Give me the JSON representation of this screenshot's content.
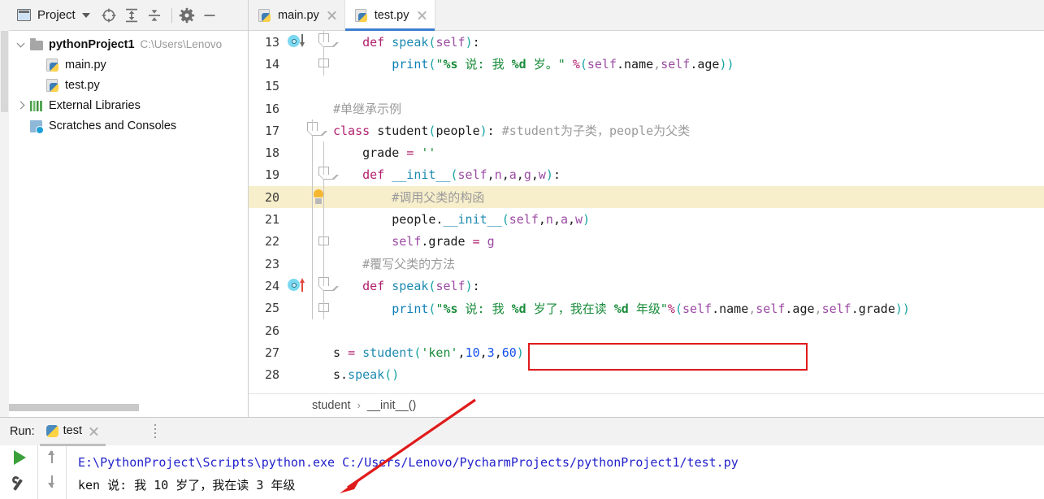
{
  "window": {
    "project_panel": {
      "title": "Project",
      "toolbar_icons": [
        "locate-icon",
        "expand-all-icon",
        "collapse-all-icon",
        "settings-gear-icon",
        "minimize-icon"
      ],
      "tree": [
        {
          "label": "pythonProject1",
          "path_hint": "C:\\Users\\Lenovo",
          "icon": "folder-icon",
          "twisty": "open",
          "depth": 0,
          "bold": true
        },
        {
          "label": "main.py",
          "path_hint": "",
          "icon": "python-file-icon",
          "twisty": "none",
          "depth": 1,
          "bold": false
        },
        {
          "label": "test.py",
          "path_hint": "",
          "icon": "python-file-icon",
          "twisty": "none",
          "depth": 1,
          "bold": false
        },
        {
          "label": "External Libraries",
          "path_hint": "",
          "icon": "library-icon",
          "twisty": "closed",
          "depth": 0,
          "bold": false
        },
        {
          "label": "Scratches and Consoles",
          "path_hint": "",
          "icon": "scratches-icon",
          "twisty": "none",
          "depth": 0,
          "bold": false
        }
      ]
    },
    "editor": {
      "tabs": [
        {
          "label": "main.py",
          "active": false
        },
        {
          "label": "test.py",
          "active": true
        }
      ],
      "breadcrumb": {
        "parts": [
          "student",
          "__init__()"
        ],
        "separator": "›"
      },
      "lines": [
        {
          "num": "13",
          "gutter": "impl-down",
          "fold": "top",
          "indent": 1,
          "html": "<span class='indent1'></span><span class='kw'>def</span> <span class='fn'>speak</span><span class='par'>(</span><span class='self'>self</span><span class='par'>)</span>:"
        },
        {
          "num": "14",
          "gutter": "",
          "fold": "bot",
          "indent": 2,
          "html": "<span class='indent2'></span><span class='bip'>print</span><span class='par'>(</span><span class='str'>\"</span><span class='strf'>%s</span><span class='str'> 说: 我 </span><span class='strf'>%d</span><span class='str'> 岁。\"</span> <span class='pct'>%</span><span class='par'>(</span><span class='self'>self</span>.name<span class='com'>,</span><span class='self'>self</span>.age<span class='par'>))</span>"
        },
        {
          "num": "15",
          "gutter": "",
          "fold": "",
          "indent": 0,
          "html": ""
        },
        {
          "num": "16",
          "gutter": "",
          "fold": "",
          "indent": 0,
          "html": "<span class='com'>#单继承示例</span>"
        },
        {
          "num": "17",
          "gutter": "",
          "fold": "top-flat",
          "indent": 0,
          "html": "<span class='kw'>class</span> <span class='cls'>student</span><span class='par'>(</span>people<span class='par'>)</span>: <span class='com'>#student为子类，people为父类</span>"
        },
        {
          "num": "18",
          "gutter": "",
          "fold": "",
          "indent": 1,
          "html": "<span class='indent1'></span>grade <span class='op'>=</span> <span class='str'>''</span>"
        },
        {
          "num": "19",
          "gutter": "",
          "fold": "top",
          "indent": 1,
          "html": "<span class='indent1'></span><span class='kw'>def</span> <span class='fn'>__init__</span><span class='par'>(</span><span class='self'>self</span>,<span class='var'>n</span>,<span class='var'>a</span>,<span class='var'>g</span>,<span class='var'>w</span><span class='par'>)</span>:"
        },
        {
          "num": "20",
          "gutter": "bulb",
          "fold": "",
          "indent": 2,
          "highlight": true,
          "html": "<span class='indent2'></span><span class='com'>#调用父类的构函</span>"
        },
        {
          "num": "21",
          "gutter": "",
          "fold": "",
          "indent": 2,
          "html": "<span class='indent2'></span>people.<span class='fn'>__init__</span><span class='par'>(</span><span class='self'>self</span>,<span class='var'>n</span>,<span class='var'>a</span>,<span class='var'>w</span><span class='par'>)</span>"
        },
        {
          "num": "22",
          "gutter": "",
          "fold": "bot",
          "indent": 2,
          "html": "<span class='indent2'></span><span class='self'>self</span>.grade <span class='op'>=</span> <span class='var'>g</span>"
        },
        {
          "num": "23",
          "gutter": "",
          "fold": "",
          "indent": 1,
          "html": "<span class='indent1'></span><span class='com'>#覆写父类的方法</span>"
        },
        {
          "num": "24",
          "gutter": "over-up",
          "fold": "top",
          "indent": 1,
          "html": "<span class='indent1'></span><span class='kw'>def</span> <span class='fn'>speak</span><span class='par'>(</span><span class='self'>self</span><span class='par'>)</span>:"
        },
        {
          "num": "25",
          "gutter": "",
          "fold": "bot",
          "indent": 2,
          "html": "<span class='indent2'></span><span class='bip'>print</span><span class='par'>(</span><span class='str'>\"</span><span class='strf'>%s</span><span class='str'> 说: 我 </span><span class='strf'>%d</span><span class='str'> 岁了，我在读 </span><span class='strf'>%d</span><span class='str'> 年级\"</span><span class='pct'>%</span><span class='par'>(</span><span class='self'>self</span>.name<span class='com'>,</span><span class='self'>self</span>.age<span class='com'>,</span><span class='self'>self</span>.grade<span class='par'>))</span>"
        },
        {
          "num": "26",
          "gutter": "",
          "fold": "",
          "indent": 0,
          "html": ""
        },
        {
          "num": "27",
          "gutter": "",
          "fold": "",
          "indent": 0,
          "html": "s <span class='op'>=</span> <span class='fn'>student</span><span class='par'>(</span><span class='str'>'ken'</span>,<span class='num'>10</span>,<span class='num'>3</span>,<span class='num'>60</span><span class='par'>)</span>"
        },
        {
          "num": "28",
          "gutter": "",
          "fold": "",
          "indent": 0,
          "html": "s.<span class='fn'>speak</span><span class='par'>()</span>"
        }
      ],
      "annotation": {
        "type": "red-rectangle",
        "target_line": "27"
      }
    },
    "run_panel": {
      "label": "Run:",
      "tab_label": "test",
      "buttons": [
        "run-icon",
        "wrench-icon",
        "scroll-up-icon",
        "scroll-down-icon"
      ],
      "console": [
        {
          "text": "E:\\PythonProject\\Scripts\\python.exe C:/Users/Lenovo/PycharmProjects/pythonProject1/test.py",
          "kind": "command"
        },
        {
          "text": "ken 说: 我 10 岁了，我在读 3 年级",
          "kind": "output"
        }
      ],
      "annotation": {
        "type": "red-arrow",
        "points_to": "console-output-line"
      }
    }
  },
  "colors": {
    "accent_blue": "#3c7fd0",
    "annotation_red": "#e01b1b",
    "highlight_yellow": "#f7eecb",
    "run_green": "#3aa13a",
    "console_command": "#2222cc"
  }
}
